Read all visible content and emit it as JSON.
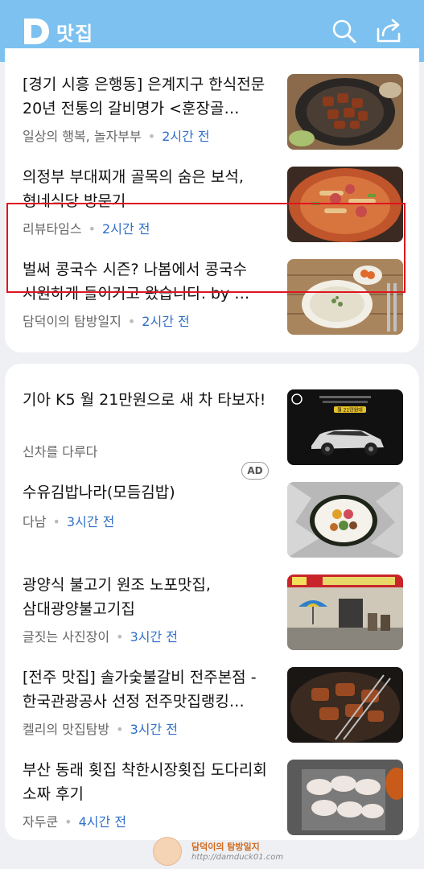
{
  "header": {
    "brand": "맛집"
  },
  "feed1": [
    {
      "title": "[경기 시흥 은행동] 은계지구 한식전문 20년 전통의 갈비명가 <훈장골…",
      "source": "일상의 행복, 놀자부부",
      "time": "2시간 전"
    },
    {
      "title": "의정부 부대찌개 골목의 숨은 보석, 형네식당 방문기",
      "source": "리뷰타임스",
      "time": "2시간 전"
    },
    {
      "title": "벌써 콩국수 시즌? 나봄에서 콩국수 시원하게 들이키고 왔습니다. by …",
      "source": "담덕이의 탐방일지",
      "time": "2시간 전"
    }
  ],
  "feed2": [
    {
      "title": "기아 K5 월 21만원으로 새 차 타보자!",
      "source": "신차를 다루다",
      "ad": "AD",
      "thumb_text": "월 21만원대"
    },
    {
      "title": "수유김밥나라(모듬김밥)",
      "source": "다남",
      "time": "3시간 전"
    },
    {
      "title": "광양식 불고기 원조 노포맛집, 삼대광양불고기집",
      "source": "글짓는 사진장이",
      "time": "3시간 전"
    },
    {
      "title": "[전주 맛집] 솔가숯불갈비 전주본점 - 한국관광공사 선정 전주맛집랭킹…",
      "source": "켈리의 맛집탐방",
      "time": "3시간 전"
    },
    {
      "title": "부산 동래 횟집 착한시장횟집 도다리회 소짜 후기",
      "source": "자두쿤",
      "time": "4시간 전"
    }
  ],
  "watermark": {
    "line1": "담덕이의 탐방일지",
    "line2": "http://damduck01.com"
  },
  "colors": {
    "header": "#7cc1f0",
    "time": "#2f6fc9",
    "highlight": "#e0141f"
  }
}
